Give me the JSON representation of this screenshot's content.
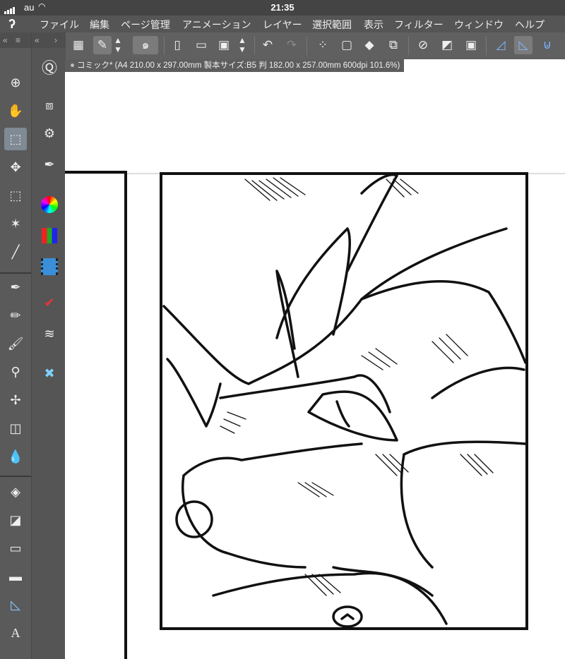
{
  "status_bar": {
    "carrier": "au",
    "time": "21:35"
  },
  "menu": {
    "items": [
      "ファイル",
      "編集",
      "ページ管理",
      "アニメーション",
      "レイヤー",
      "選択範囲",
      "表示",
      "フィルター",
      "ウィンドウ",
      "ヘルプ"
    ]
  },
  "document_tab": {
    "title": "コミック* (A4 210.00 x 297.00mm 製本サイズ:B5 判 182.00 x 257.00mm 600dpi 101.6%)"
  },
  "tools": [
    "zoom-icon",
    "hand-icon",
    "operation-icon",
    "move-layer-icon",
    "selection-icon",
    "auto-select-icon",
    "eyedropper-icon",
    "pen-icon",
    "pencil-icon",
    "brush-icon",
    "airbrush-icon",
    "decoration-icon",
    "eraser-icon",
    "blend-icon",
    "fill-icon",
    "gradient-icon",
    "figure-icon",
    "frame-border-icon",
    "ruler-icon",
    "text-icon"
  ],
  "command_panel": [
    "quick-access-icon",
    "layer-property-icon",
    "tool-property-icon",
    "sub-tool-detail-icon",
    "color-wheel-icon",
    "color-set-icon",
    "timeline-icon",
    "history-icon",
    "layer-icon",
    "material-icon"
  ],
  "text_tool_label": "A"
}
